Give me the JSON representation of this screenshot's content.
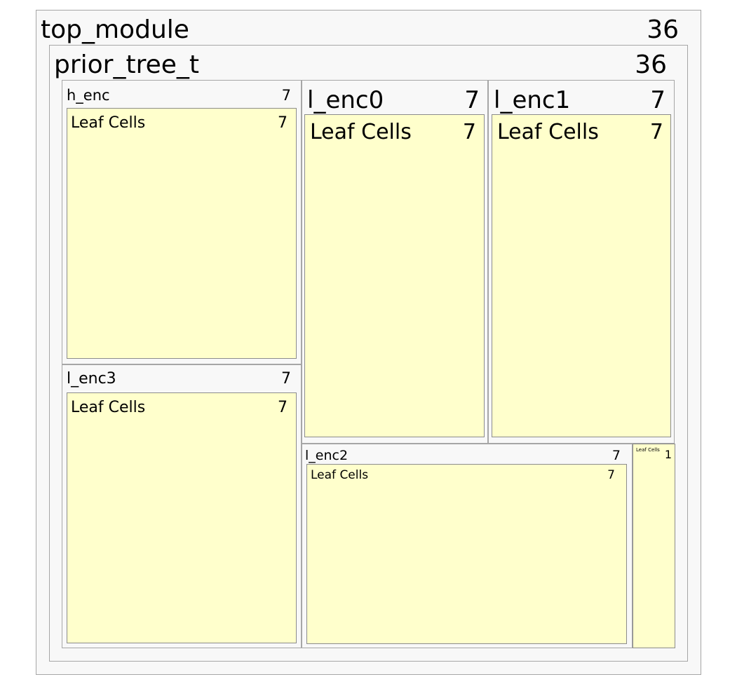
{
  "top_module": {
    "name": "top_module",
    "count": "36"
  },
  "prior_tree": {
    "name": "prior_tree_t",
    "count": "36"
  },
  "h_enc": {
    "name": "h_enc",
    "count": "7",
    "leaf": {
      "name": "Leaf Cells",
      "count": "7"
    }
  },
  "l_enc0": {
    "name": "l_enc0",
    "count": "7",
    "leaf": {
      "name": "Leaf Cells",
      "count": "7"
    }
  },
  "l_enc1": {
    "name": "l_enc1",
    "count": "7",
    "leaf": {
      "name": "Leaf Cells",
      "count": "7"
    }
  },
  "l_enc3": {
    "name": "l_enc3",
    "count": "7",
    "leaf": {
      "name": "Leaf Cells",
      "count": "7"
    }
  },
  "l_enc2": {
    "name": "l_enc2",
    "count": "7",
    "leaf": {
      "name": "Leaf Cells",
      "count": "7"
    }
  },
  "prior_leaf": {
    "name": "Leaf Cells",
    "count": "1"
  },
  "colors": {
    "module_fill": "#f8f8f8",
    "leaf_fill": "#ffffcc",
    "border": "#a6a6a6"
  }
}
